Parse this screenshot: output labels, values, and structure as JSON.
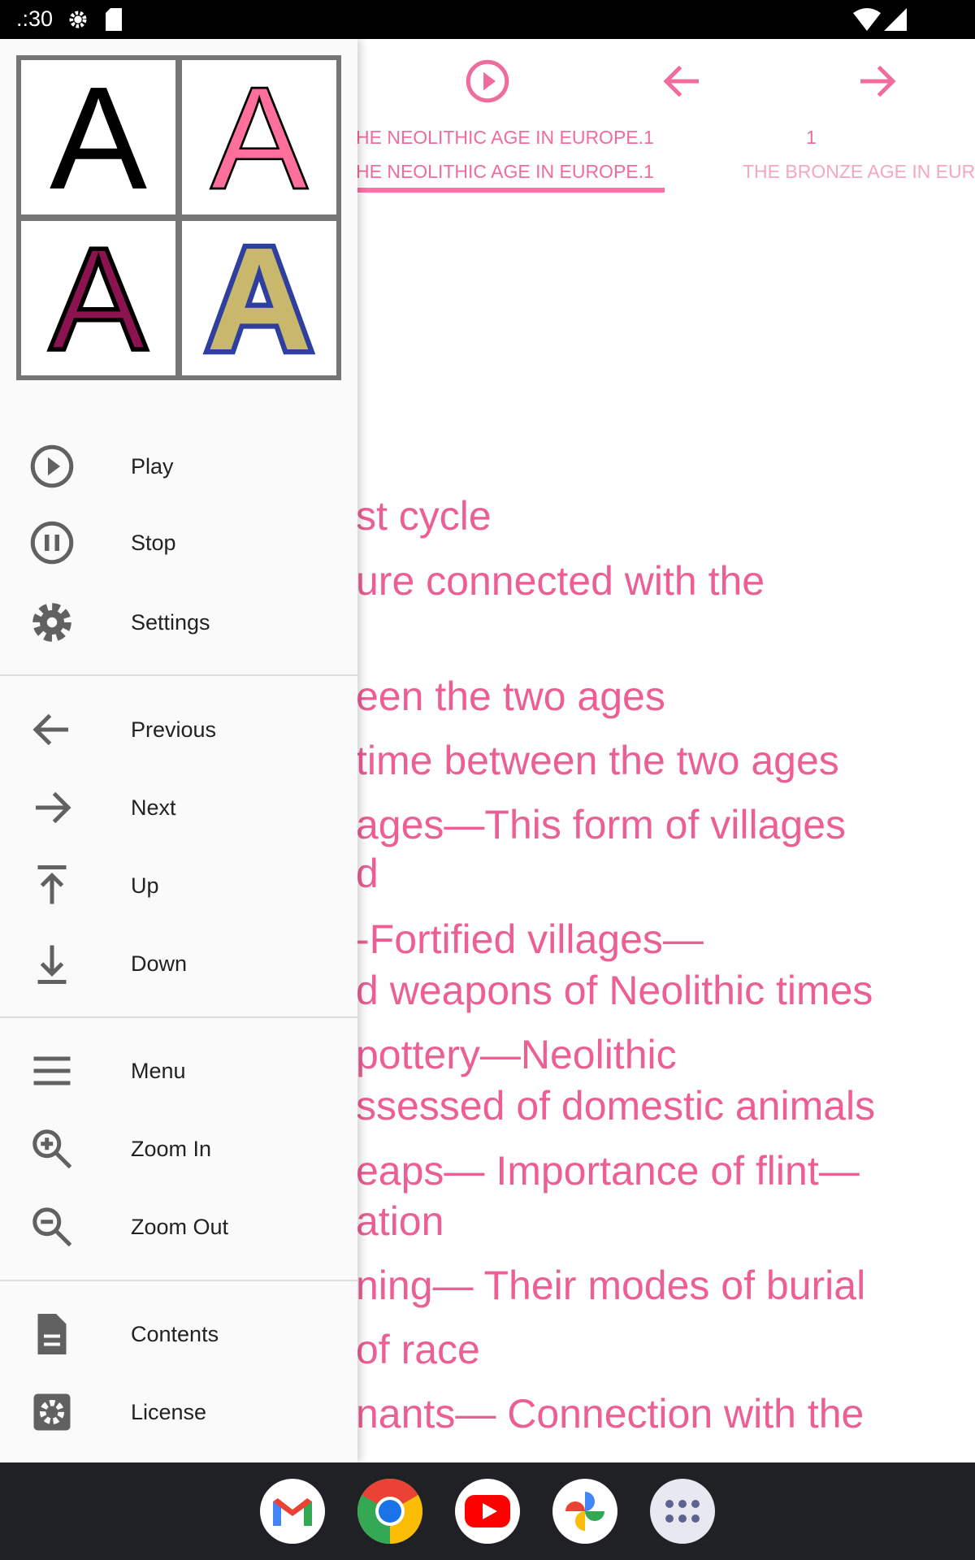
{
  "status_bar": {
    "time": ".:30",
    "icons": [
      "settings-gear-icon",
      "sd-card-icon",
      "wifi-icon",
      "signal-icon"
    ]
  },
  "toolbar": {
    "icons": [
      "play-icon",
      "arrow-left-icon",
      "arrow-right-icon"
    ]
  },
  "tabs": [
    {
      "title": "HE NEOLITHIC AGE IN EUROPE.1",
      "subtitle": "HE NEOLITHIC AGE IN EUROPE.1",
      "selected": true
    },
    {
      "title": "1",
      "subtitle": "THE BRONZE AGE IN EURO",
      "selected": false
    }
  ],
  "content": {
    "lines": [
      "st cycle",
      "ure connected with the",
      "een the two ages",
      "time between the two ages",
      "ages—This form of villages",
      "d",
      "-Fortified villages—",
      "d weapons of Neolithic times",
      "pottery—Neolithic",
      "ssessed of domestic animals",
      "eaps— Importance of flint—",
      "ation",
      "ning— Their modes of burial",
      "of race",
      "nants— Connection with the"
    ]
  },
  "theme_tiles": [
    {
      "letter": "A",
      "fill": "#000000",
      "stroke": "none"
    },
    {
      "letter": "A",
      "fill": "#ff6f9c",
      "stroke": "#000000"
    },
    {
      "letter": "A",
      "fill": "#8b1450",
      "stroke": "#000000"
    },
    {
      "letter": "A",
      "fill": "#c9b86b",
      "stroke": "#2e3f9e"
    }
  ],
  "drawer": {
    "items": [
      {
        "label": "Play",
        "icon": "play-circle-icon"
      },
      {
        "label": "Stop",
        "icon": "pause-circle-icon"
      },
      {
        "label": "Settings",
        "icon": "gear-icon"
      },
      {
        "label": "Previous",
        "icon": "arrow-left-icon"
      },
      {
        "label": "Next",
        "icon": "arrow-right-icon"
      },
      {
        "label": "Up",
        "icon": "arrow-up-to-top-icon"
      },
      {
        "label": "Down",
        "icon": "arrow-down-to-bottom-icon"
      },
      {
        "label": "Menu",
        "icon": "menu-icon"
      },
      {
        "label": "Zoom In",
        "icon": "zoom-in-icon"
      },
      {
        "label": "Zoom Out",
        "icon": "zoom-out-icon"
      },
      {
        "label": "Contents",
        "icon": "document-icon"
      },
      {
        "label": "License",
        "icon": "settings-box-icon"
      }
    ]
  },
  "dock": [
    "gmail-icon",
    "chrome-icon",
    "youtube-icon",
    "photos-icon",
    "app-drawer-icon"
  ],
  "colors": {
    "accent": "#f06b9e",
    "text": "#ec5f94"
  }
}
